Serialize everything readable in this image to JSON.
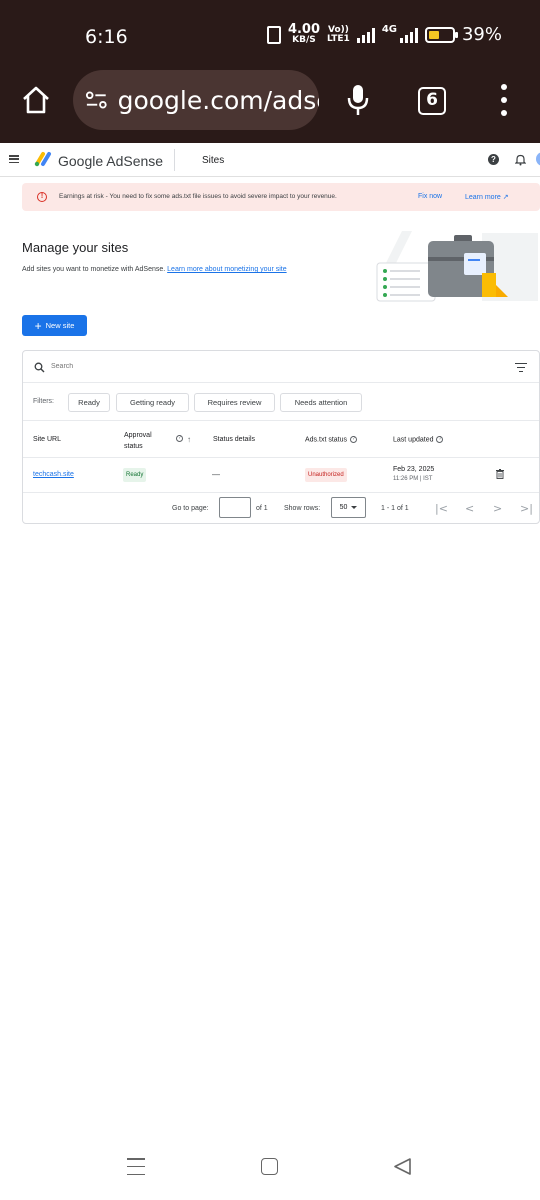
{
  "status_bar": {
    "time": "6:16",
    "net_speed_value": "4.00",
    "net_speed_unit": "KB/S",
    "volte_line1": "Vo))",
    "volte_line2": "LTE1",
    "network_type": "4G",
    "battery_percent": "39%",
    "battery_level": 0.39
  },
  "browser": {
    "url": "google.com/adse",
    "tab_count": "6"
  },
  "app": {
    "product_name": "Google AdSense",
    "section": "Sites"
  },
  "alert": {
    "message": "Earnings at risk - You need to fix some ads.txt file issues to avoid severe impact to your revenue.",
    "fix_label": "Fix now",
    "learn_label": "Learn more"
  },
  "page": {
    "title": "Manage your sites",
    "description": "Add sites you want to monetize with AdSense.",
    "description_link": "Learn more about monetizing your site",
    "new_site_label": "New site"
  },
  "table": {
    "search_placeholder": "Search",
    "filters_label": "Filters:",
    "filters": [
      "Ready",
      "Getting ready",
      "Requires review",
      "Needs attention"
    ],
    "columns": {
      "site_url": "Site URL",
      "approval_line1": "Approval",
      "approval_line2": "status",
      "status_details": "Status details",
      "ads_txt": "Ads.txt status",
      "last_updated": "Last updated"
    },
    "rows": [
      {
        "site": "techcash.site",
        "approval": "Ready",
        "details": "—",
        "ads_txt": "Unauthorized",
        "date": "Feb 23, 2025",
        "time": "11:26 PM | IST"
      }
    ],
    "pager": {
      "go_to_label": "Go to page:",
      "of_label": "of 1",
      "rows_label": "Show rows:",
      "rows_value": "50",
      "range": "1 - 1 of 1"
    }
  }
}
